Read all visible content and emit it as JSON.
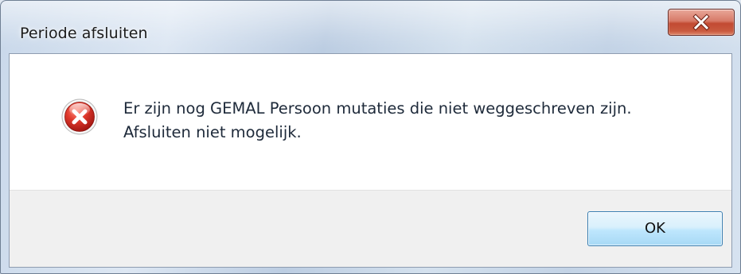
{
  "window": {
    "title": "Periode afsluiten",
    "close_icon": "close-icon",
    "close_button_color": "#c24a32"
  },
  "message": {
    "icon": "error-icon",
    "icon_color": "#d42a22",
    "lines": [
      "Er zijn nog GEMAL Persoon mutaties die niet weggeschreven zijn.",
      "Afsluiten niet mogelijk."
    ]
  },
  "buttons": {
    "ok_label": "OK",
    "ok_color": "#3c7fb1"
  }
}
